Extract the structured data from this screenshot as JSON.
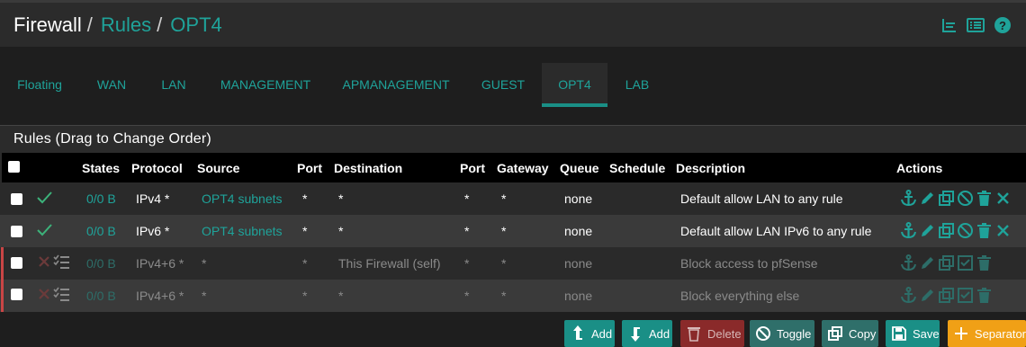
{
  "breadcrumb": {
    "first": "Firewall",
    "second": "Rules",
    "third": "OPT4",
    "separator": "/"
  },
  "top_icons": [
    "chart-icon",
    "list-icon",
    "help-icon"
  ],
  "tabs": [
    {
      "label": "Floating"
    },
    {
      "label": "WAN"
    },
    {
      "label": "LAN"
    },
    {
      "label": "MANAGEMENT"
    },
    {
      "label": "APMANAGEMENT"
    },
    {
      "label": "GUEST"
    },
    {
      "label": "OPT4",
      "active": true
    },
    {
      "label": "LAB"
    }
  ],
  "panel": {
    "title": "Rules (Drag to Change Order)"
  },
  "table": {
    "headers": {
      "states": "States",
      "protocol": "Protocol",
      "source": "Source",
      "port": "Port",
      "destination": "Destination",
      "port2": "Port",
      "gateway": "Gateway",
      "queue": "Queue",
      "schedule": "Schedule",
      "description": "Description",
      "actions": "Actions"
    },
    "rows": [
      {
        "status": "check-icon",
        "states": "0/0 B",
        "protocol": "IPv4 *",
        "source": "OPT4 subnets",
        "port": "*",
        "destination": "*",
        "port2": "*",
        "gateway": "*",
        "queue": "none",
        "schedule": "",
        "description": "Default allow LAN to any rule",
        "enabled": true
      },
      {
        "status": "check-icon",
        "states": "0/0 B",
        "protocol": "IPv6 *",
        "source": "OPT4 subnets",
        "port": "*",
        "destination": "*",
        "port2": "*",
        "gateway": "*",
        "queue": "none",
        "schedule": "",
        "description": "Default allow LAN IPv6 to any rule",
        "enabled": true
      },
      {
        "status": "block-icon",
        "states": "0/0 B",
        "protocol": "IPv4+6 *",
        "source": "*",
        "port": "*",
        "destination": "This Firewall (self)",
        "port2": "*",
        "gateway": "*",
        "queue": "none",
        "schedule": "",
        "description": "Block access to pfSense",
        "enabled": false
      },
      {
        "status": "block-icon",
        "states": "0/0 B",
        "protocol": "IPv4+6 *",
        "source": "*",
        "port": "*",
        "destination": "*",
        "port2": "*",
        "gateway": "*",
        "queue": "none",
        "schedule": "",
        "description": "Block everything else",
        "enabled": false
      }
    ]
  },
  "buttons": {
    "add_top": "Add",
    "add_bottom": "Add",
    "delete": "Delete",
    "toggle": "Toggle",
    "copy": "Copy",
    "save": "Save",
    "separator": "Separator"
  },
  "colors": {
    "accent": "#1fa39a",
    "background": "#1e1e1e",
    "panel": "#2b2b2b",
    "header": "#000000",
    "danger": "#c94545",
    "orange": "#f0a016"
  }
}
